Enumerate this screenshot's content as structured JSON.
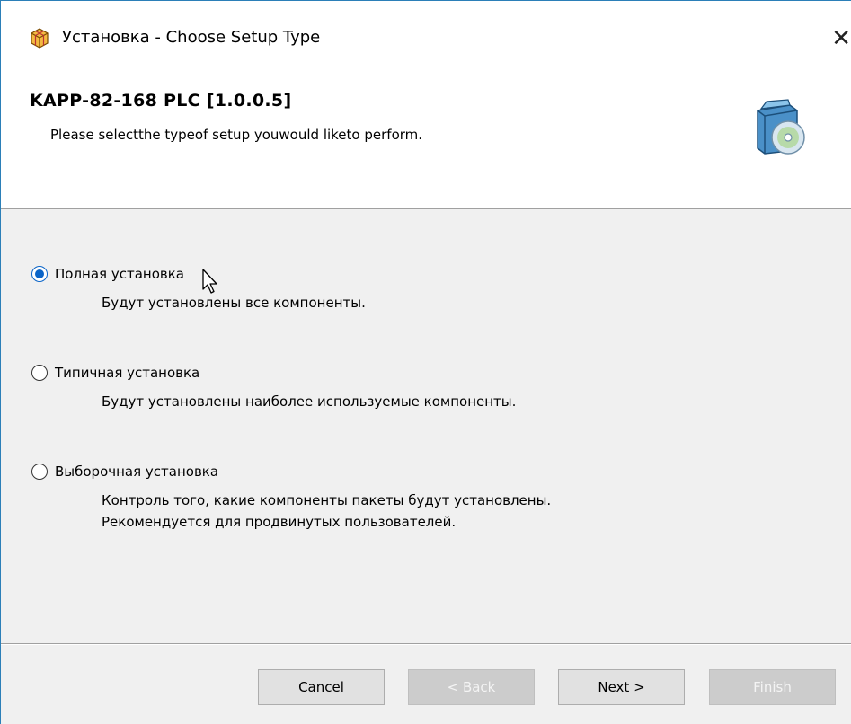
{
  "window": {
    "title": "Установка - Choose Setup Type",
    "close_glyph": "✕"
  },
  "header": {
    "product_title": "KAPP-82-168 PLC [1.0.0.5]",
    "subtitle": "Please selectthe typeof setup youwould liketo perform."
  },
  "options": [
    {
      "label": "Полная установка",
      "description": [
        "Будут установлены все компоненты."
      ],
      "selected": true
    },
    {
      "label": "Типичная установка",
      "description": [
        "Будут установлены наиболее используемые компоненты."
      ],
      "selected": false
    },
    {
      "label": "Выборочная установка",
      "description": [
        "Контроль того, какие компоненты пакеты будут установлены.",
        "Рекомендуется для продвинутых пользователей."
      ],
      "selected": false
    }
  ],
  "buttons": {
    "cancel": "Cancel",
    "back": "< Back",
    "next": "Next >",
    "finish": "Finish"
  },
  "icons": {
    "app": "installer-box-icon",
    "header": "setup-cd-box-icon",
    "cursor": "mouse-pointer-icon"
  },
  "colors": {
    "accent": "#0a64c8",
    "disabled_button": "#cccccc"
  }
}
